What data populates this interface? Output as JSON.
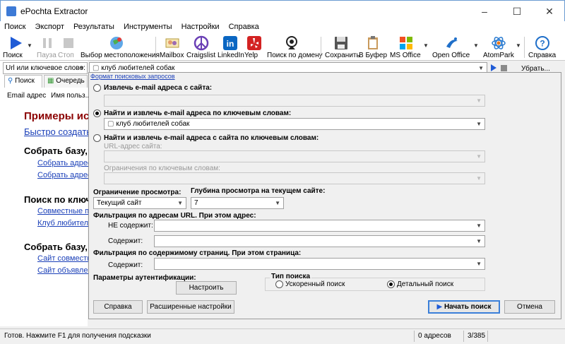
{
  "window": {
    "title": "ePochta Extractor"
  },
  "menu": [
    "Поиск",
    "Экспорт",
    "Результаты",
    "Инструменты",
    "Настройки",
    "Справка"
  ],
  "toolbar": {
    "search": "Поиск",
    "pause": "Пауза",
    "stop": "Стоп",
    "location": "Выбор местоположения",
    "mailbox": "Mailbox",
    "craigslist": "Craigslist",
    "linkedin": "LinkedIn",
    "yelp": "Yelp",
    "domain": "Поиск по домену",
    "save": "Сохранить",
    "clipboard": "В Буфер",
    "msoffice": "MS Office",
    "openoffice": "Open Office",
    "atompark": "AtomPark",
    "help": "Справка"
  },
  "left": {
    "combo": "Url или ключевое слово:",
    "tabs": [
      "Поиск",
      "Очередь"
    ],
    "columns": [
      "Email адрес",
      "Имя польз..."
    ],
    "heading": "Примеры ис",
    "quick_link": "Быстро создать",
    "sections": [
      {
        "title": "Собрать базу,",
        "links": [
          "Собрать адреса",
          "Собрать адреса"
        ]
      },
      {
        "title": "Поиск по ключе",
        "links": [
          "Совместные пок",
          "Клуб любителей"
        ]
      },
      {
        "title": "Собрать базу,",
        "links": [
          "Сайт совместны",
          "Сайт объявлени"
        ]
      }
    ]
  },
  "dialog": {
    "url_value": "клуб любителей собак",
    "clear_label": "Убрать...",
    "syntax_link": "Формат поисковых запросов",
    "opt1": "Извлечь e-mail адреса с сайта:",
    "opt2": "Найти и извлечь e-mail адреса по ключевым словам:",
    "opt2_value": "клуб любителей собак",
    "opt3": "Найти и извлечь e-mail адреса с сайта по ключевым словам:",
    "url_label": "URL-адрес сайта:",
    "kw_limit_label": "Ограничения по ключевым словам:",
    "view_limit_label": "Ограничение просмотра:",
    "view_limit_value": "Текущий сайт",
    "depth_label": "Глубина просмотра на текущем сайте:",
    "depth_value": "7",
    "url_filter_label": "Фильтрация по адресам URL. При этом адрес:",
    "not_contains": "НЕ содержит:",
    "contains": "Содержит:",
    "content_filter_label": "Фильтрация по содержимому страниц. При этом страница:",
    "contains2": "Содержит:",
    "auth_label": "Параметры аутентификации:",
    "configure": "Настроить",
    "search_type": "Тип поиска",
    "fast": "Ускоренный поиск",
    "detailed": "Детальный поиск",
    "help_btn": "Справка",
    "advanced_btn": "Расширенные настройки",
    "start_btn": "Начать поиск",
    "cancel_btn": "Отмена"
  },
  "status": {
    "hint": "Готов. Нажмите F1 для получения подсказки",
    "count": "0 адресов",
    "progress": "3/385"
  }
}
